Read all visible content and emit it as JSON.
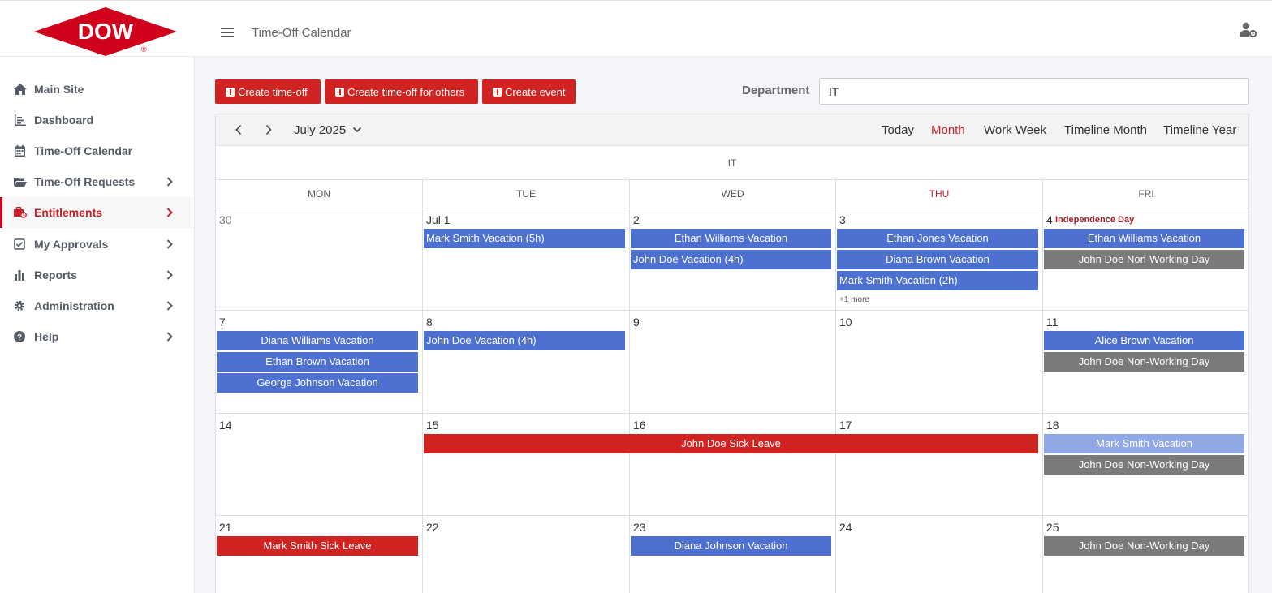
{
  "brand": {
    "logo_text": "DOW",
    "logo_color": "#d0021b"
  },
  "header": {
    "title": "Time-Off Calendar"
  },
  "sidebar": {
    "items": [
      {
        "label": "Main Site",
        "icon": "home-icon",
        "chevron": false
      },
      {
        "label": "Dashboard",
        "icon": "chart-icon",
        "chevron": false
      },
      {
        "label": "Time-Off Calendar",
        "icon": "calendar-icon",
        "chevron": false
      },
      {
        "label": "Time-Off Requests",
        "icon": "folder-icon",
        "chevron": true
      },
      {
        "label": "Entitlements",
        "icon": "briefcase-clock-icon",
        "chevron": true,
        "active": true
      },
      {
        "label": "My Approvals",
        "icon": "checkbox-icon",
        "chevron": true
      },
      {
        "label": "Reports",
        "icon": "bar-chart-icon",
        "chevron": true
      },
      {
        "label": "Administration",
        "icon": "gear-icon",
        "chevron": true
      },
      {
        "label": "Help",
        "icon": "question-circle-icon",
        "chevron": true
      }
    ]
  },
  "toolbar": {
    "create_timeoff": "Create time-off",
    "create_timeoff_others": "Create time-off for others",
    "create_event": "Create event",
    "department_label": "Department",
    "department_value": "IT"
  },
  "calendar": {
    "month_label": "July 2025",
    "views": [
      "Today",
      "Month",
      "Work Week",
      "Timeline Month",
      "Timeline Year"
    ],
    "active_view": "Month",
    "group": "IT",
    "weekdays": [
      "MON",
      "TUE",
      "WED",
      "THU",
      "FRI"
    ],
    "today_weekday": "THU",
    "weeks": [
      [
        "30",
        "Jul 1",
        "2",
        "3",
        "4"
      ],
      [
        "7",
        "8",
        "9",
        "10",
        "11"
      ],
      [
        "14",
        "15",
        "16",
        "17",
        "18"
      ],
      [
        "21",
        "22",
        "23",
        "24",
        "25"
      ]
    ],
    "holiday": "Independence Day",
    "more_label": "+1 more",
    "events": {
      "w0_tue_1": "Mark Smith Vacation (5h)",
      "w0_wed_1": "Ethan Williams Vacation",
      "w0_wed_2": "John Doe Vacation (4h)",
      "w0_thu_1": "Ethan Jones Vacation",
      "w0_thu_2": "Diana Brown Vacation",
      "w0_thu_3": "Mark Smith Vacation (2h)",
      "w0_fri_1": "Ethan Williams Vacation",
      "w0_fri_2": "John Doe Non-Working Day",
      "w1_mon_1": "Diana Williams Vacation",
      "w1_mon_2": "Ethan Brown Vacation",
      "w1_mon_3": "George Johnson Vacation",
      "w1_tue_1": "John Doe Vacation (4h)",
      "w1_fri_1": "Alice Brown Vacation",
      "w1_fri_2": "John Doe Non-Working Day",
      "w2_span": "John Doe Sick Leave",
      "w2_fri_1": "Mark Smith Vacation",
      "w2_fri_2": "John Doe Non-Working Day",
      "w3_mon_1": "Mark Smith Sick Leave",
      "w3_wed_1": "Diana Johnson Vacation",
      "w3_fri_1": "John Doe Non-Working Day"
    },
    "colors": {
      "vacation": "#4e70d1",
      "non_working": "#7a7a7a",
      "sick": "#d22323",
      "accent": "#c8202a"
    }
  }
}
